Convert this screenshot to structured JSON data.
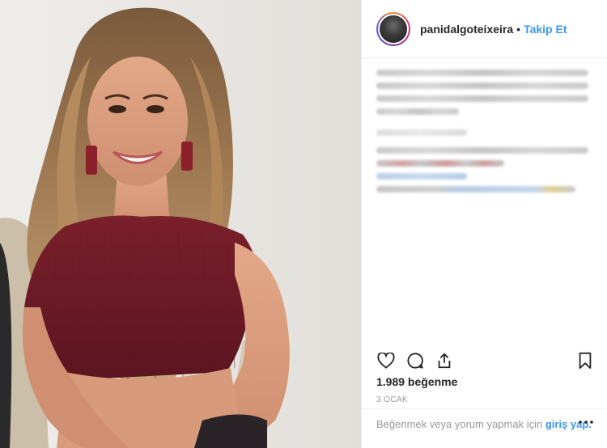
{
  "post": {
    "username": "panidalgoteixeira",
    "separator": "•",
    "follow_label": "Takip Et",
    "likes": "1.989 beğenme",
    "date": "3 OCAK"
  },
  "footer": {
    "prompt": "Beğenmek veya yorum yapmak için ",
    "login_label": "giriş yap."
  },
  "icons": {
    "like": "heart-icon",
    "comment": "comment-icon",
    "share": "share-icon",
    "save": "bookmark-icon",
    "more": "more-icon"
  },
  "colors": {
    "link": "#3897f0",
    "text": "#262626",
    "muted": "#999999",
    "border": "#efefef"
  }
}
